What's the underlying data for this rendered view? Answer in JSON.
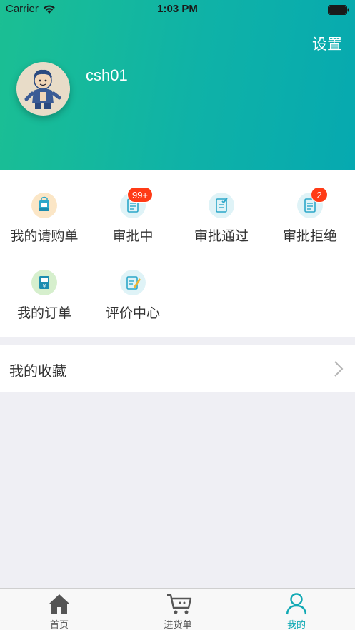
{
  "status_bar": {
    "carrier": "Carrier",
    "time": "1:03 PM"
  },
  "header": {
    "settings_label": "设置",
    "username": "csh01"
  },
  "menu": {
    "items": [
      {
        "label": "我的请购单",
        "icon": "shopping-bag-icon"
      },
      {
        "label": "审批中",
        "icon": "document-icon",
        "badge": "99+"
      },
      {
        "label": "审批通过",
        "icon": "approved-document-icon"
      },
      {
        "label": "审批拒绝",
        "icon": "document-icon",
        "badge": "2"
      },
      {
        "label": "我的订单",
        "icon": "order-yen-icon"
      },
      {
        "label": "评价中心",
        "icon": "edit-note-icon"
      }
    ]
  },
  "favorites": {
    "label": "我的收藏"
  },
  "tabbar": {
    "tabs": [
      {
        "label": "首页",
        "icon": "home-icon",
        "active": false
      },
      {
        "label": "进货单",
        "icon": "cart-icon",
        "active": false
      },
      {
        "label": "我的",
        "icon": "user-icon",
        "active": true
      }
    ]
  },
  "colors": {
    "header_gradient_start": "#1bbf93",
    "header_gradient_end": "#06a9b0",
    "badge": "#ff3b16",
    "active_tab": "#11a9b4"
  }
}
